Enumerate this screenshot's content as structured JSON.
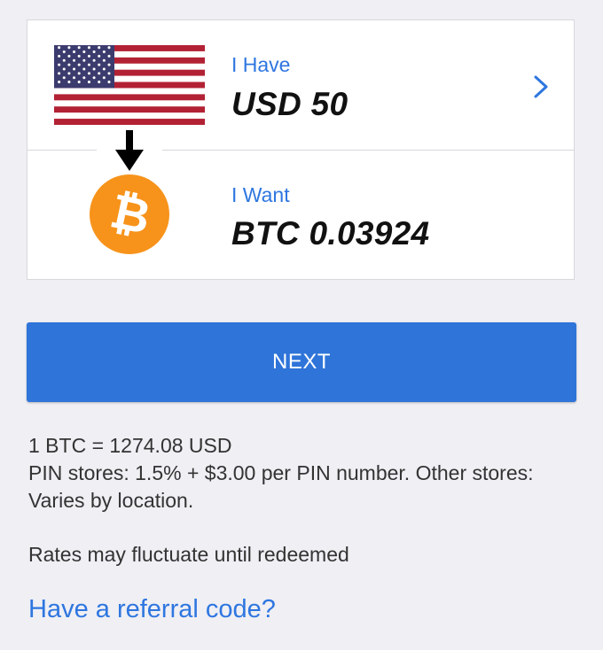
{
  "have": {
    "label": "I Have",
    "value": "USD 50",
    "flag_icon": "us-flag-icon",
    "chevron_icon": "chevron-right-icon"
  },
  "want": {
    "label": "I Want",
    "value": "BTC 0.03924",
    "coin_icon": "bitcoin-icon"
  },
  "next_button": {
    "label": "NEXT"
  },
  "info": {
    "rate": "1 BTC = 1274.08 USD",
    "fees": "PIN stores: 1.5% + $3.00 per PIN number. Other stores: Varies by location.",
    "disclaimer": "Rates may fluctuate until redeemed"
  },
  "referral_link": "Have a referral code?",
  "colors": {
    "accent": "#2e74d9",
    "link": "#2e76e0",
    "bitcoin": "#f7931a",
    "background": "#efeff4"
  }
}
